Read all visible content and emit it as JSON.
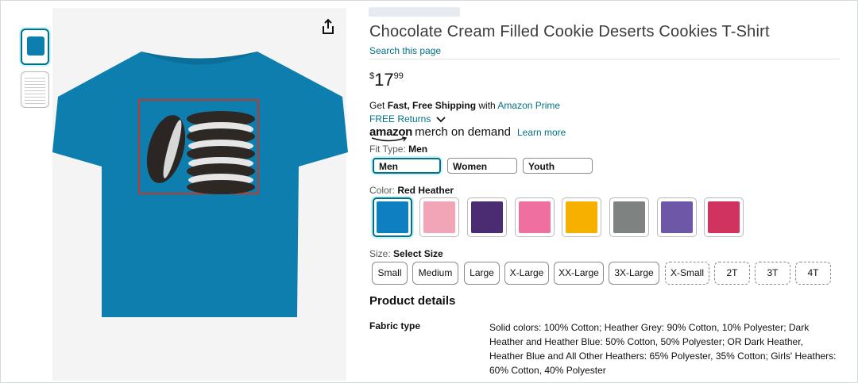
{
  "product": {
    "title": "Chocolate Cream Filled Cookie Deserts Cookies T-Shirt",
    "search_link": "Search this page",
    "price": {
      "symbol": "$",
      "whole": "17",
      "fraction": "99"
    }
  },
  "shipping": {
    "prefix": "Get ",
    "bold": "Fast, Free Shipping",
    "with": " with ",
    "prime": "Amazon Prime",
    "returns": "FREE Returns"
  },
  "merch": {
    "brand": "amazon",
    "tagline": "merch on demand",
    "learn_more": "Learn more"
  },
  "fit": {
    "label": "Fit Type: ",
    "selected": "Men",
    "options": [
      "Men",
      "Women",
      "Youth"
    ]
  },
  "color": {
    "label": "Color: ",
    "selected": "Red Heather",
    "swatches": [
      "#0e7fc1",
      "#f2a5b6",
      "#4b2b72",
      "#ef6fa0",
      "#f5b000",
      "#7e8280",
      "#6d58a8",
      "#d1335f"
    ]
  },
  "size": {
    "label": "Size: ",
    "selected": "Select Size",
    "options": [
      "Small",
      "Medium",
      "Large",
      "X-Large",
      "XX-Large",
      "3X-Large",
      "X-Small",
      "2T",
      "3T",
      "4T"
    ]
  },
  "details": {
    "title": "Product details",
    "fabric_key": "Fabric type",
    "fabric_value": "Solid colors: 100% Cotton; Heather Grey: 90% Cotton, 10% Polyester; Dark Heather and Heather Blue: 50% Cotton, 50% Polyester; OR Dark Heather, Heather Blue and All Other Heathers: 65% Polyester, 35% Cotton; Girls' Heathers: 60% Cotton, 40% Polyester"
  },
  "icons": {
    "share": "share-icon",
    "chevron": "chevron-down-icon"
  },
  "colors": {
    "link": "#007185",
    "shirt": "#0e7eae",
    "accent": "#c8f3fa"
  }
}
